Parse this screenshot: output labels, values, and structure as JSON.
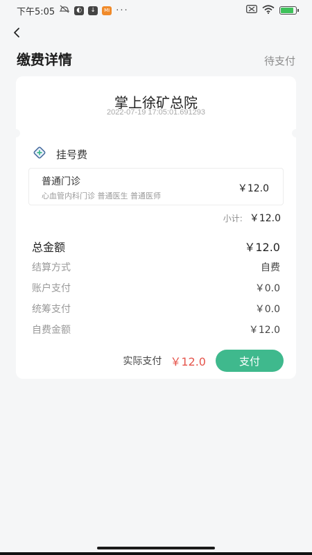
{
  "status_bar": {
    "time": "下午5:05",
    "app_badge_text": "MI",
    "more": "···",
    "icons": [
      "mute-icon",
      "app-icon",
      "download-icon",
      "mi-icon",
      "sim-icon",
      "wifi-icon",
      "battery-icon"
    ],
    "battery_level": 0.85
  },
  "header": {
    "title": "缴费详情",
    "status": "待支付"
  },
  "card": {
    "hospital_name": "掌上徐矿总院",
    "timestamp": "2022-07-19 17:05:01.691293",
    "section_title": "挂号费",
    "section_icon": "plus-diamond-icon",
    "item": {
      "name": "普通门诊",
      "desc": "心血管内科门诊 普通医生 普通医师",
      "price": "￥12.0"
    },
    "subtotal_label": "小计:",
    "subtotal_value": "￥12.0",
    "rows": [
      {
        "label": "总金额",
        "value": "￥12.0"
      },
      {
        "label": "结算方式",
        "value": "自费"
      },
      {
        "label": "账户支付",
        "value": "￥0.0"
      },
      {
        "label": "统筹支付",
        "value": "￥0.0"
      },
      {
        "label": "自费金额",
        "value": "￥12.0"
      }
    ],
    "actual_label": "实际支付",
    "actual_amount": "￥12.0",
    "pay_button": "支付"
  },
  "colors": {
    "accent": "#3fb98d",
    "amount_red": "#e5544b",
    "background": "#f5f6f7"
  }
}
